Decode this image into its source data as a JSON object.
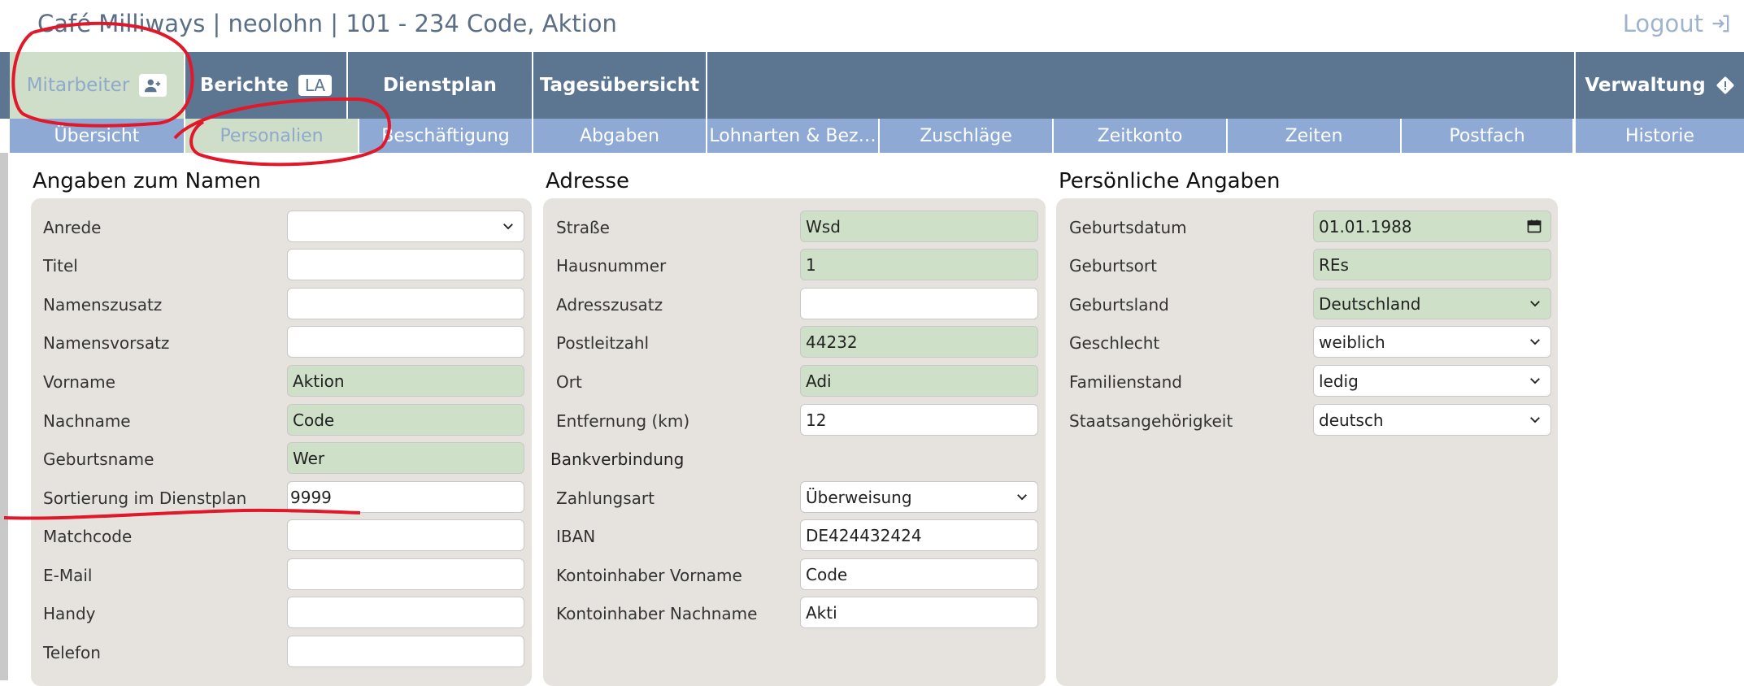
{
  "header": {
    "title": "Café Milliways | neolohn | 101 - 234 Code, Aktion",
    "logout_label": "Logout"
  },
  "main_nav": {
    "items": [
      {
        "label": "Mitarbeiter",
        "icon": "person-add-icon"
      },
      {
        "label": "Berichte",
        "badge": "LA"
      },
      {
        "label": "Dienstplan"
      },
      {
        "label": "Tagesübersicht"
      },
      {
        "label": "Verwaltung",
        "icon": "alert-diamond-icon"
      }
    ]
  },
  "sub_nav": {
    "items": [
      {
        "label": "Übersicht"
      },
      {
        "label": "Personalien"
      },
      {
        "label": "Beschäftigung"
      },
      {
        "label": "Abgaben"
      },
      {
        "label": "Lohnarten & Bez…"
      },
      {
        "label": "Zuschläge"
      },
      {
        "label": "Zeitkonto"
      },
      {
        "label": "Zeiten"
      },
      {
        "label": "Postfach"
      },
      {
        "label": "Historie"
      }
    ]
  },
  "name_section": {
    "title": "Angaben zum Namen",
    "fields": [
      {
        "label": "Anrede",
        "value": "",
        "type": "select"
      },
      {
        "label": "Titel",
        "value": ""
      },
      {
        "label": "Namenszusatz",
        "value": ""
      },
      {
        "label": "Namensvorsatz",
        "value": ""
      },
      {
        "label": "Vorname",
        "value": "Aktion"
      },
      {
        "label": "Nachname",
        "value": "Code"
      },
      {
        "label": "Geburtsname",
        "value": "Wer"
      },
      {
        "label": "Sortierung im Dienstplan",
        "value": "9999"
      },
      {
        "label": "Matchcode",
        "value": ""
      },
      {
        "label": "E-Mail",
        "value": ""
      },
      {
        "label": "Handy",
        "value": ""
      },
      {
        "label": "Telefon",
        "value": ""
      }
    ]
  },
  "address_section": {
    "title": "Adresse",
    "fields": [
      {
        "label": "Straße",
        "value": "Wsd"
      },
      {
        "label": "Hausnummer",
        "value": "1"
      },
      {
        "label": "Adresszusatz",
        "value": ""
      },
      {
        "label": "Postleitzahl",
        "value": "44232"
      },
      {
        "label": "Ort",
        "value": "Adi"
      },
      {
        "label": "Entfernung (km)",
        "value": "12"
      }
    ],
    "bank_heading": "Bankverbindung",
    "bank_fields": [
      {
        "label": "Zahlungsart",
        "value": "Überweisung",
        "type": "select"
      },
      {
        "label": "IBAN",
        "value": "DE424432424"
      },
      {
        "label": "Kontoinhaber Vorname",
        "value": "Code"
      },
      {
        "label": "Kontoinhaber Nachname",
        "value": "Akti"
      }
    ]
  },
  "personal_section": {
    "title": "Persönliche Angaben",
    "fields": [
      {
        "label": "Geburtsdatum",
        "value": "01.01.1988",
        "type": "date"
      },
      {
        "label": "Geburtsort",
        "value": "REs"
      },
      {
        "label": "Geburtsland",
        "value": "Deutschland",
        "type": "select"
      },
      {
        "label": "Geschlecht",
        "value": "weiblich",
        "type": "select"
      },
      {
        "label": "Familienstand",
        "value": "ledig",
        "type": "select"
      },
      {
        "label": "Staatsangehörigkeit",
        "value": "deutsch",
        "type": "select"
      }
    ]
  },
  "colors": {
    "nav_bg": "#5c7590",
    "subnav_bg": "#8eaad4",
    "active_bg": "#cfdec9",
    "filled_field": "#cfe0c9",
    "panel_bg": "#e6e2dd",
    "annotation": "#e0182a"
  }
}
